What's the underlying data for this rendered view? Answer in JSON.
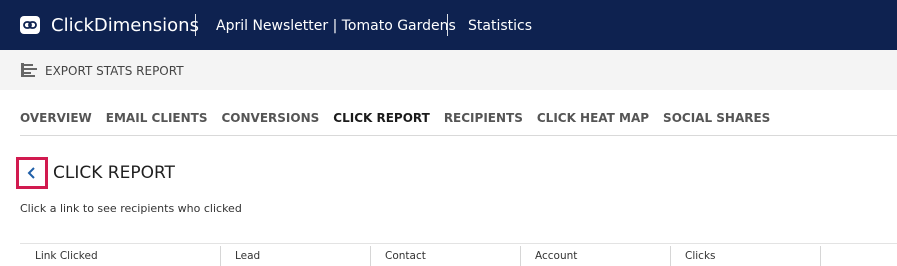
{
  "app": {
    "brand": "ClickDimensions",
    "record_title": "April Newsletter | Tomato Gardens",
    "section": "Statistics",
    "header_bg": "#0e2250"
  },
  "commandbar": {
    "export_label": "EXPORT STATS REPORT",
    "export_icon": "report-icon"
  },
  "tabs": [
    {
      "label": "OVERVIEW",
      "active": false
    },
    {
      "label": "EMAIL CLIENTS",
      "active": false
    },
    {
      "label": "CONVERSIONS",
      "active": false
    },
    {
      "label": "CLICK REPORT",
      "active": true
    },
    {
      "label": "RECIPIENTS",
      "active": false
    },
    {
      "label": "CLICK HEAT MAP",
      "active": false
    },
    {
      "label": "SOCIAL SHARES",
      "active": false
    }
  ],
  "main": {
    "title": "CLICK REPORT",
    "subtitle": "Click a link to see recipients who clicked",
    "back_icon": "chevron-left-icon",
    "highlight_color": "#d11a4f"
  },
  "table": {
    "columns": [
      "Link Clicked",
      "Lead",
      "Contact",
      "Account",
      "Clicks"
    ]
  }
}
